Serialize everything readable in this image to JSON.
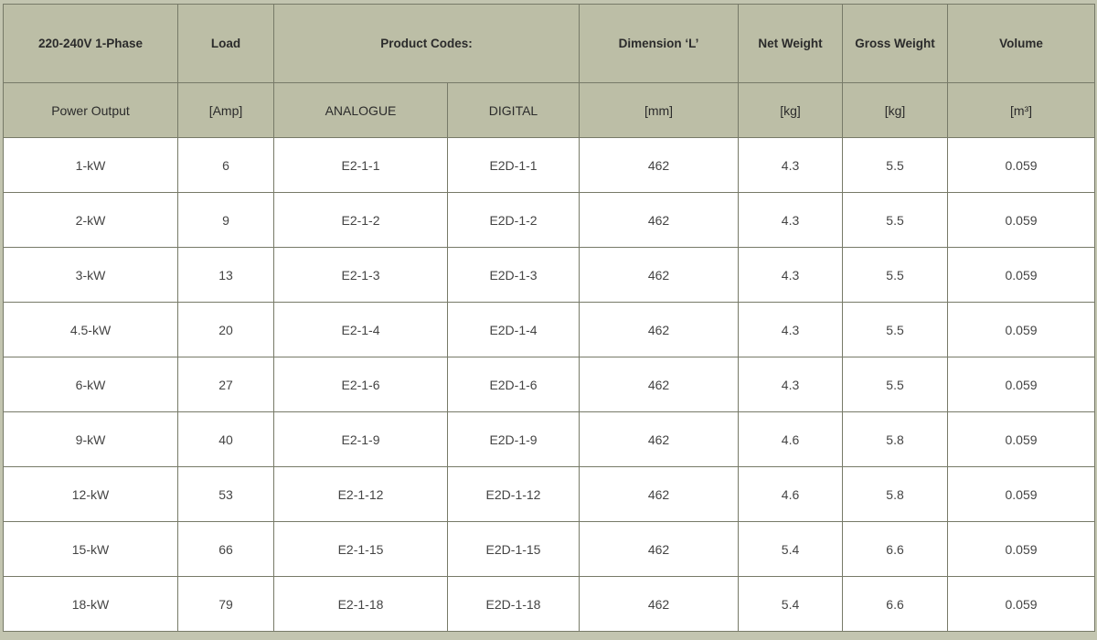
{
  "header": {
    "row1": {
      "phase": "220-240V 1-Phase",
      "load": "Load",
      "product_codes": "Product Codes:",
      "dimension": "Dimension ‘L’",
      "net_weight": "Net Weight",
      "gross_weight": "Gross Weight",
      "volume": "Volume"
    },
    "row2": {
      "power_output": "Power Output",
      "amp": "[Amp]",
      "analogue": "ANALOGUE",
      "digital": "DIGITAL",
      "mm": "[mm]",
      "kg_net": "[kg]",
      "kg_gross": "[kg]",
      "m3": "[m³]"
    }
  },
  "rows": [
    [
      "1-kW",
      "6",
      "E2-1-1",
      "E2D-1-1",
      "462",
      "4.3",
      "5.5",
      "0.059"
    ],
    [
      "2-kW",
      "9",
      "E2-1-2",
      "E2D-1-2",
      "462",
      "4.3",
      "5.5",
      "0.059"
    ],
    [
      "3-kW",
      "13",
      "E2-1-3",
      "E2D-1-3",
      "462",
      "4.3",
      "5.5",
      "0.059"
    ],
    [
      "4.5-kW",
      "20",
      "E2-1-4",
      "E2D-1-4",
      "462",
      "4.3",
      "5.5",
      "0.059"
    ],
    [
      "6-kW",
      "27",
      "E2-1-6",
      "E2D-1-6",
      "462",
      "4.3",
      "5.5",
      "0.059"
    ],
    [
      "9-kW",
      "40",
      "E2-1-9",
      "E2D-1-9",
      "462",
      "4.6",
      "5.8",
      "0.059"
    ],
    [
      "12-kW",
      "53",
      "E2-1-12",
      "E2D-1-12",
      "462",
      "4.6",
      "5.8",
      "0.059"
    ],
    [
      "15-kW",
      "66",
      "E2-1-15",
      "E2D-1-15",
      "462",
      "5.4",
      "6.6",
      "0.059"
    ],
    [
      "18-kW",
      "79",
      "E2-1-18",
      "E2D-1-18",
      "462",
      "5.4",
      "6.6",
      "0.059"
    ]
  ]
}
